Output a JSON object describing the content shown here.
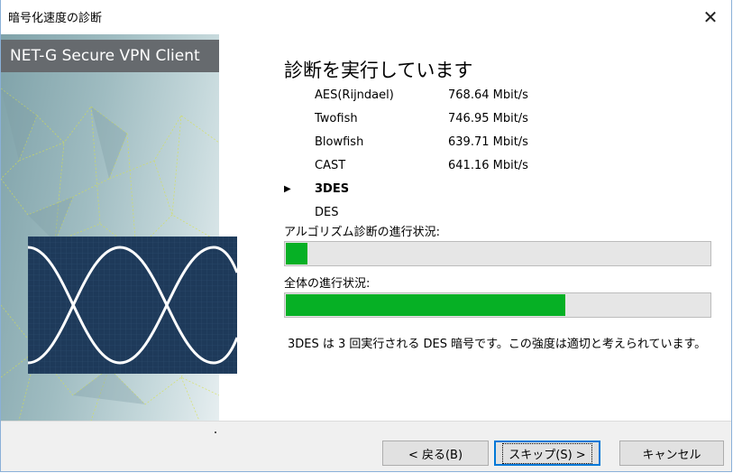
{
  "window": {
    "title": "暗号化速度の診断",
    "close_glyph": "✕"
  },
  "banner": {
    "brand": "NET-G Secure VPN Client"
  },
  "main": {
    "heading": "診断を実行しています",
    "current_marker": "▶",
    "algorithms": [
      {
        "name": "AES(Rijndael)",
        "speed": "768.64 Mbit/s"
      },
      {
        "name": "Twofish",
        "speed": "746.95 Mbit/s"
      },
      {
        "name": "Blowfish",
        "speed": "639.71 Mbit/s"
      },
      {
        "name": "CAST",
        "speed": "641.16 Mbit/s"
      },
      {
        "name": "3DES",
        "speed": "",
        "current": true
      },
      {
        "name": "DES",
        "speed": ""
      }
    ],
    "algo_progress_label": "アルゴリズム診断の進行状況:",
    "algo_progress_percent": 5,
    "total_progress_label": "全体の進行状況:",
    "total_progress_percent": 66,
    "description": "3DES は 3 回実行される DES 暗号です。この強度は適切と考えられています。"
  },
  "footer": {
    "back_label": "< 戻る(B)",
    "skip_label": "スキップ(S) >",
    "cancel_label": "キャンセル"
  },
  "colors": {
    "progress_fill": "#06b025",
    "default_button_border": "#0078d7"
  }
}
